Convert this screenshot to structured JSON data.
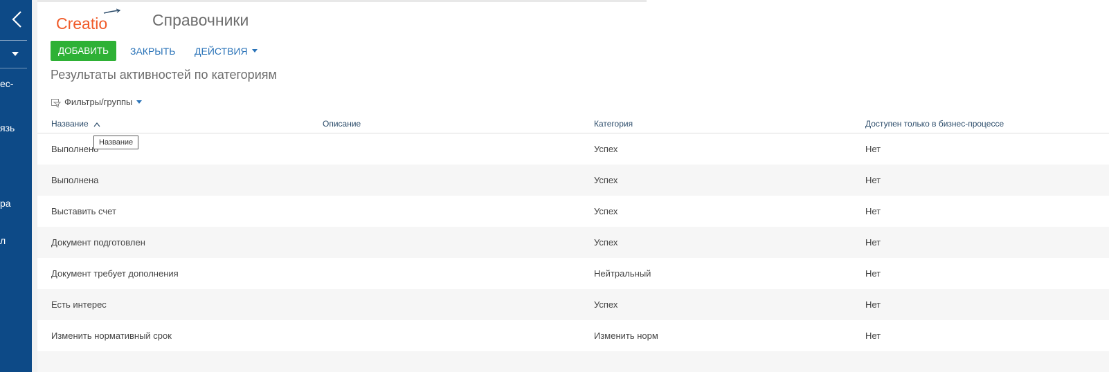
{
  "sidebar": {
    "fragments": [
      "ес-",
      "язь",
      "ра",
      "л"
    ]
  },
  "header": {
    "logo_text": "Creatio",
    "title": "Справочники"
  },
  "toolbar": {
    "add_label": "ДОБАВИТЬ",
    "close_label": "ЗАКРЫТЬ",
    "actions_label": "ДЕЙСТВИЯ"
  },
  "section": {
    "title": "Результаты активностей по категориям",
    "filters_label": "Фильтры/группы"
  },
  "grid": {
    "columns": [
      "Название",
      "Описание",
      "Категория",
      "Доступен только в бизнес-процессе"
    ],
    "sort": "ascending",
    "tooltip": "Название",
    "rows": [
      {
        "name": "Выполнено",
        "description": "",
        "category": "Успех",
        "bp_only": "Нет"
      },
      {
        "name": "Выполнена",
        "description": "",
        "category": "Успех",
        "bp_only": "Нет"
      },
      {
        "name": "Выставить счет",
        "description": "",
        "category": "Успех",
        "bp_only": "Нет"
      },
      {
        "name": "Документ подготовлен",
        "description": "",
        "category": "Успех",
        "bp_only": "Нет"
      },
      {
        "name": "Документ требует дополнения",
        "description": "",
        "category": "Нейтральный",
        "bp_only": "Нет"
      },
      {
        "name": "Есть интерес",
        "description": "",
        "category": "Успех",
        "bp_only": "Нет"
      },
      {
        "name": "Изменить нормативный срок",
        "description": "",
        "category": "Изменить норм",
        "bp_only": "Нет"
      }
    ]
  },
  "colors": {
    "sidebar": "#0d4a87",
    "add_button": "#2eb135",
    "link": "#2a73b8",
    "logo": "#f05a28"
  },
  "icons": [
    "back-arrow-icon",
    "chevron-down-icon",
    "filter-icon",
    "sort-ascending-icon"
  ]
}
